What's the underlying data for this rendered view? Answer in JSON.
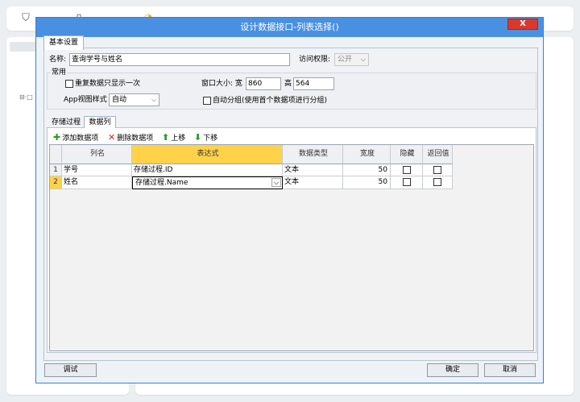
{
  "background": {
    "top_items": [
      "shield-icon",
      "page-icon",
      "gauge-icon"
    ]
  },
  "dialog": {
    "title": "设计数据接口-列表选择()",
    "close_label": "X",
    "top_tab": "基本设置",
    "name_label": "名称:",
    "name_value": "查询学号与姓名",
    "access_label": "访问权限:",
    "access_value": "公开",
    "group_title": "常用",
    "repeat_only_once": "重复数据只显示一次",
    "window_size_label": "窗口大小: 宽",
    "width_value": "860",
    "height_label": "高",
    "height_value": "564",
    "app_view_label": "App视图样式",
    "app_view_value": "自动",
    "auto_group_label": "自动分组(使用首个数据项进行分组)",
    "sub_tabs": [
      "存储过程",
      "数据列"
    ],
    "toolbar": {
      "add": "添加数据项",
      "delete": "删除数据项",
      "up": "上移",
      "down": "下移"
    },
    "grid": {
      "headers": [
        "列名",
        "表达式",
        "数据类型",
        "宽度",
        "隐藏",
        "返回值"
      ],
      "rows": [
        {
          "n": "1",
          "name": "学号",
          "expr": "存储过程.ID",
          "type": "文本",
          "width": "50"
        },
        {
          "n": "2",
          "name": "姓名",
          "expr": "存储过程.Name",
          "type": "文本",
          "width": "50"
        }
      ]
    },
    "buttons": {
      "debug": "调试",
      "ok": "确定",
      "cancel": "取消"
    }
  }
}
